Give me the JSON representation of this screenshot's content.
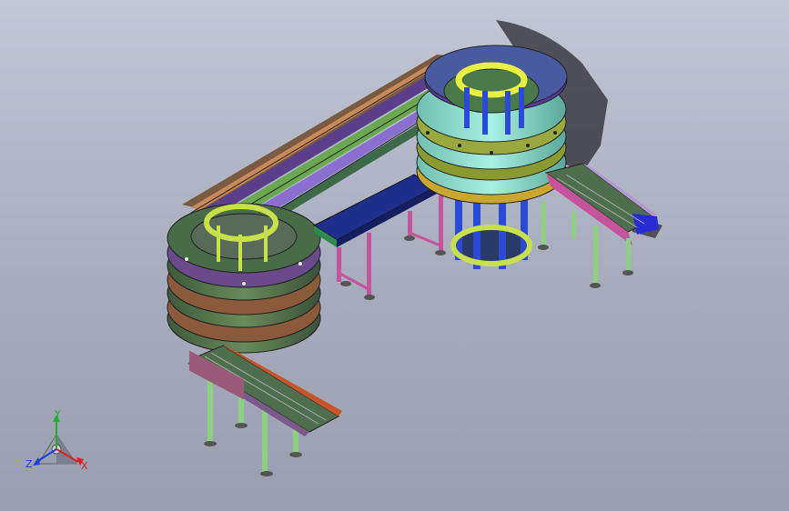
{
  "viewport": {
    "background_top": "#c2c7d6",
    "background_bottom": "#9a9fb0"
  },
  "model": {
    "description_icon": "spiral-conveyor-assembly-icon",
    "colors": {
      "spiral_tower_left": "#4a6b4a",
      "spiral_tower_right": "#8fe0d0",
      "lime_ring": "#c8e04a",
      "blue_column": "#2b4bd6",
      "magenta_frame": "#c6549a",
      "orange_rail": "#c8552a",
      "navy_belt": "#1e2e8a",
      "purple_accent": "#7a44c8",
      "green_rail": "#6aa850"
    }
  },
  "triad": {
    "x_label": "X",
    "y_label": "Y",
    "z_label": "Z",
    "x_color": "#e02020",
    "y_color": "#20b030",
    "z_color": "#2040e0"
  }
}
